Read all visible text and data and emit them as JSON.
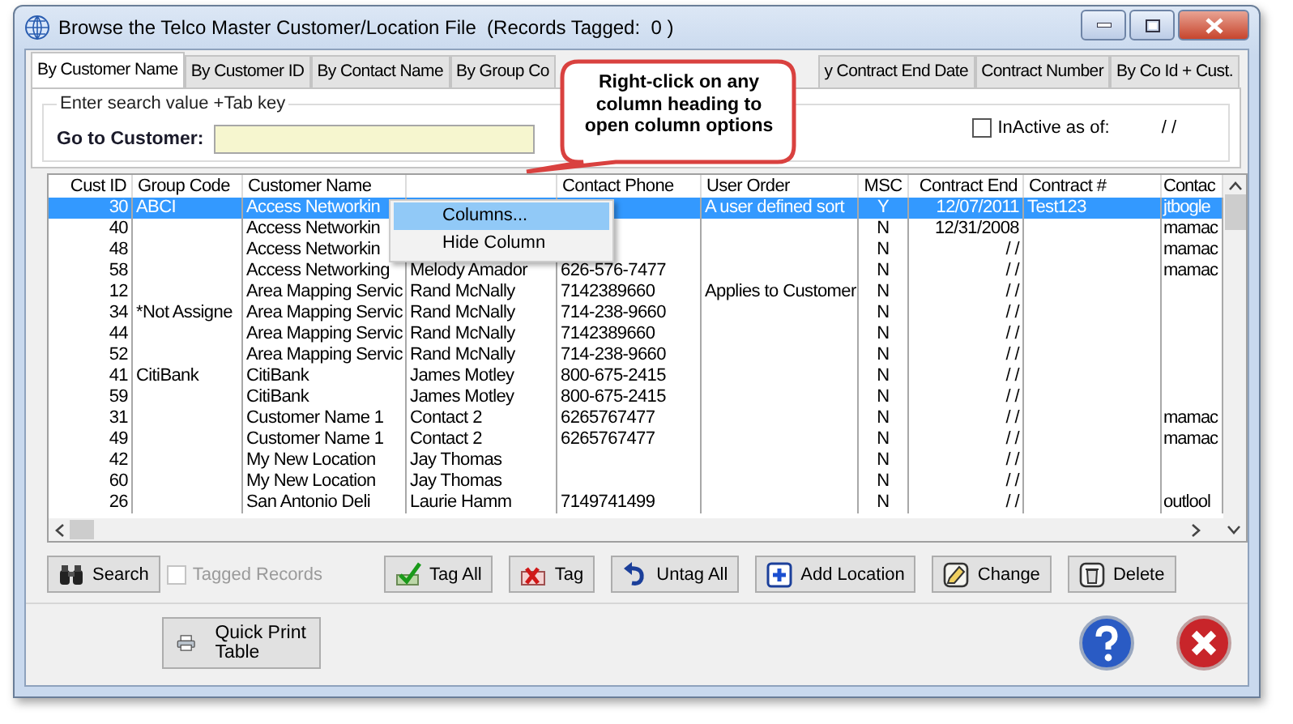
{
  "window": {
    "title": "Browse the Telco Master Customer/Location File  (Records Tagged:  0 )"
  },
  "tabs": [
    {
      "label": "By Customer Name",
      "selected": true
    },
    {
      "label": "By Customer ID",
      "selected": false
    },
    {
      "label": "By Contact Name",
      "selected": false
    },
    {
      "label": "By Group Co",
      "selected": false
    },
    {
      "label": "y Contract End Date",
      "selected": false
    },
    {
      "label": "Contract Number",
      "selected": false
    },
    {
      "label": "By Co Id + Cust.",
      "selected": false
    }
  ],
  "callout": {
    "text": "Right-click on any column heading to open column options"
  },
  "search": {
    "legend": "Enter search value +Tab key",
    "label": "Go to Customer:",
    "inactive": {
      "label": "InActive as of:",
      "checked": false,
      "value": "/ /"
    }
  },
  "table": {
    "columns": [
      {
        "label": "Cust ID"
      },
      {
        "label": "Group Code"
      },
      {
        "label": "Customer Name"
      },
      {},
      {
        "label": "Contact Phone"
      },
      {
        "label": "User Order"
      },
      {
        "label": "MSC"
      },
      {
        "label": "Contract End"
      },
      {
        "label": "Contract #"
      },
      {
        "label": "Contac"
      }
    ],
    "rows": [
      {
        "selected": true,
        "cust_id": "30",
        "group_code": "ABCI",
        "customer_name": "Access Networkin",
        "user_order": "A user defined sort",
        "msc": "Y",
        "contract_end": "12/07/2011",
        "contract_no": "Test123",
        "column_10": "jtbogle"
      },
      {
        "selected": false,
        "cust_id": "40",
        "customer_name": "Access Networkin",
        "msc": "N",
        "contract_end": "12/31/2008",
        "column_10": "mamac"
      },
      {
        "selected": false,
        "cust_id": "48",
        "customer_name": "Access Networkin",
        "msc": "N",
        "contract_end": "/ /",
        "column_10": "mamac"
      },
      {
        "selected": false,
        "cust_id": "58",
        "customer_name": "Access Networking",
        "column_4": "Melody Amador",
        "contact_phone": "626-576-7477",
        "msc": "N",
        "contract_end": "/ /",
        "column_10": "mamac"
      },
      {
        "selected": false,
        "cust_id": "12",
        "customer_name": "Area Mapping Servic",
        "column_4": "Rand McNally",
        "contact_phone": "7142389660",
        "user_order": "Applies to Customer",
        "msc": "N",
        "contract_end": "/ /"
      },
      {
        "selected": false,
        "cust_id": "34",
        "group_code": "*Not Assigne",
        "customer_name": "Area Mapping Servic",
        "column_4": "Rand McNally",
        "contact_phone": "714-238-9660",
        "msc": "N",
        "contract_end": "/ /"
      },
      {
        "selected": false,
        "cust_id": "44",
        "customer_name": "Area Mapping Servic",
        "column_4": "Rand McNally",
        "contact_phone": "7142389660",
        "msc": "N",
        "contract_end": "/ /"
      },
      {
        "selected": false,
        "cust_id": "52",
        "customer_name": "Area Mapping Servic",
        "column_4": "Rand McNally",
        "contact_phone": "714-238-9660",
        "msc": "N",
        "contract_end": "/ /"
      },
      {
        "selected": false,
        "cust_id": "41",
        "group_code": "CitiBank",
        "customer_name": "CitiBank",
        "column_4": "James Motley",
        "contact_phone": "800-675-2415",
        "msc": "N",
        "contract_end": "/ /"
      },
      {
        "selected": false,
        "cust_id": "59",
        "customer_name": "CitiBank",
        "column_4": "James Motley",
        "contact_phone": "800-675-2415",
        "msc": "N",
        "contract_end": "/ /"
      },
      {
        "selected": false,
        "cust_id": "31",
        "customer_name": "Customer Name 1",
        "column_4": "Contact 2",
        "contact_phone": "6265767477",
        "msc": "N",
        "contract_end": "/ /",
        "column_10": "mamac"
      },
      {
        "selected": false,
        "cust_id": "49",
        "customer_name": "Customer Name 1",
        "column_4": "Contact 2",
        "contact_phone": "6265767477",
        "msc": "N",
        "contract_end": "/ /",
        "column_10": "mamac"
      },
      {
        "selected": false,
        "cust_id": "42",
        "customer_name": "My New Location",
        "column_4": "Jay Thomas",
        "msc": "N",
        "contract_end": "/ /"
      },
      {
        "selected": false,
        "cust_id": "60",
        "customer_name": "My New Location",
        "column_4": "Jay Thomas",
        "msc": "N",
        "contract_end": "/ /"
      },
      {
        "selected": false,
        "cust_id": "26",
        "customer_name": "San Antonio Deli",
        "column_4": "Laurie Hamm",
        "contact_phone": "7149741499",
        "msc": "N",
        "contract_end": "/ /",
        "column_10": "outlool"
      }
    ]
  },
  "context_menu": {
    "items": [
      {
        "label": "Columns...",
        "selected": true
      },
      {
        "label": "Hide Column",
        "selected": false
      }
    ]
  },
  "buttons": [
    {
      "kind": "button",
      "label": "Search"
    },
    {
      "kind": "checkbox",
      "label": "Tagged Records",
      "checked": false,
      "disabled": true
    },
    {
      "kind": "button",
      "label": "Tag All"
    },
    {
      "kind": "button",
      "label": "Tag"
    },
    {
      "kind": "button",
      "label": "Untag All"
    },
    {
      "kind": "button",
      "label": "Add Location"
    },
    {
      "kind": "button",
      "label": "Change"
    },
    {
      "kind": "button",
      "label": "Delete"
    }
  ],
  "footer": {
    "print_button": "Quick Print Table"
  }
}
